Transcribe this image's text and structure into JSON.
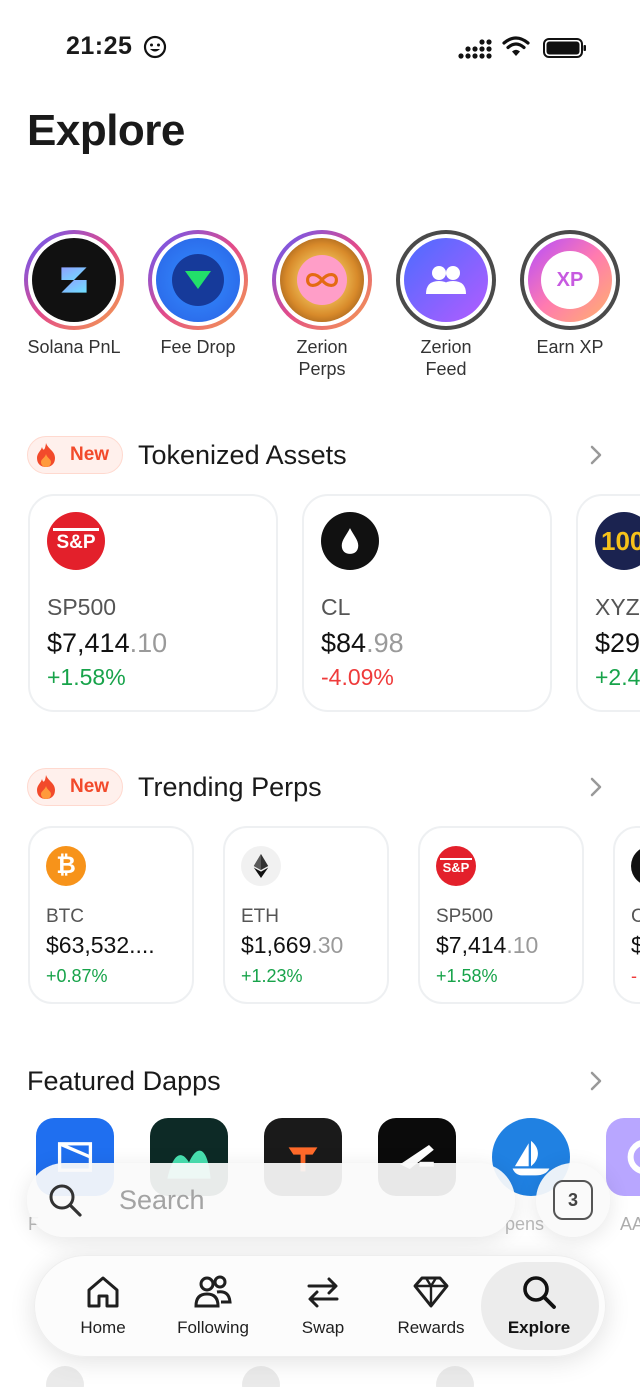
{
  "status_bar": {
    "time": "21:25",
    "emoji_icon": "smiley-face-icon",
    "signal_icon": "cellular-signal-icon",
    "wifi_icon": "wifi-icon",
    "battery_icon": "battery-icon"
  },
  "page": {
    "title": "Explore"
  },
  "stories": [
    {
      "label": "Solana PnL",
      "icon": "solana-pnl-icon"
    },
    {
      "label": "Fee Drop",
      "icon": "fee-drop-icon"
    },
    {
      "label": "Zerion\nPerps",
      "icon": "infinity-icon"
    },
    {
      "label": "Zerion\nFeed",
      "icon": "users-icon"
    },
    {
      "label": "Earn XP",
      "icon": "xp-icon",
      "badge": "XP"
    }
  ],
  "tokenized_assets": {
    "badge": "New",
    "title": "Tokenized Assets",
    "cards": [
      {
        "symbol": "SP500",
        "price_int": "$7,414",
        "price_dec": ".10",
        "change": "+1.58%",
        "direction": "up",
        "logo_text": "S&P"
      },
      {
        "symbol": "CL",
        "price_int": "$84",
        "price_dec": ".98",
        "change": "-4.09%",
        "direction": "down",
        "logo_text": ""
      },
      {
        "symbol": "XYZ",
        "price_int": "$29",
        "price_dec": "",
        "change": "+2.4",
        "direction": "up",
        "logo_text": "100"
      }
    ]
  },
  "trending_perps": {
    "badge": "New",
    "title": "Trending Perps",
    "cards": [
      {
        "symbol": "BTC",
        "price_int": "$63,532....",
        "price_dec": "",
        "change": "+0.87%",
        "direction": "up",
        "logo_text": "₿"
      },
      {
        "symbol": "ETH",
        "price_int": "$1,669",
        "price_dec": ".30",
        "change": "+1.23%",
        "direction": "up",
        "logo_text": ""
      },
      {
        "symbol": "SP500",
        "price_int": "$7,414",
        "price_dec": ".10",
        "change": "+1.58%",
        "direction": "up",
        "logo_text": "S&P"
      },
      {
        "symbol": "C",
        "price_int": "$",
        "price_dec": "",
        "change": "-",
        "direction": "down",
        "logo_text": ""
      }
    ]
  },
  "featured_dapps": {
    "title": "Featured Dapps",
    "partial_labels": [
      "F",
      "pens",
      "AA"
    ]
  },
  "search": {
    "placeholder": "Search",
    "tabs_count": "3"
  },
  "bottom_nav": [
    {
      "label": "Home",
      "icon": "home-icon",
      "active": false
    },
    {
      "label": "Following",
      "icon": "following-icon",
      "active": false
    },
    {
      "label": "Swap",
      "icon": "swap-icon",
      "active": false
    },
    {
      "label": "Rewards",
      "icon": "diamond-icon",
      "active": false
    },
    {
      "label": "Explore",
      "icon": "search-icon",
      "active": true
    }
  ],
  "colors": {
    "positive": "#17a34a",
    "negative": "#ef3b3b",
    "new_badge": "#f24a2b",
    "zerion_blue": "#2962ef"
  }
}
